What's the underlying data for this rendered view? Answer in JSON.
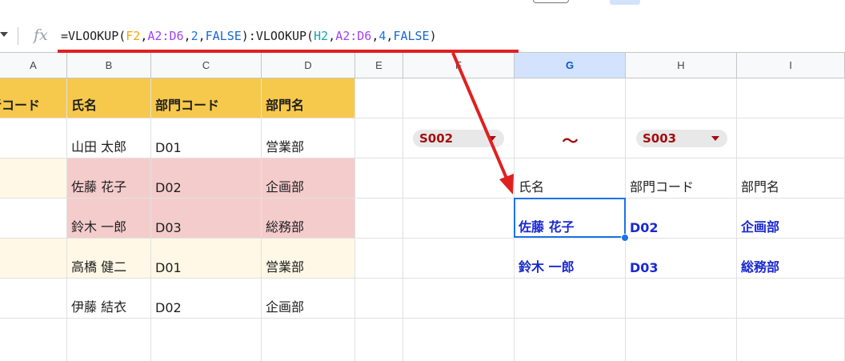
{
  "formula_bar": {
    "fx_label": "fx",
    "formula_parts": [
      {
        "text": "=VLOOKUP(",
        "cls": ""
      },
      {
        "text": "F2",
        "cls": "c-orange"
      },
      {
        "text": ",",
        "cls": ""
      },
      {
        "text": "A2:D6",
        "cls": "c-purple"
      },
      {
        "text": ",",
        "cls": ""
      },
      {
        "text": "2",
        "cls": "c-blue"
      },
      {
        "text": ",",
        "cls": ""
      },
      {
        "text": "FALSE",
        "cls": "c-navy"
      },
      {
        "text": "):VLOOKUP(",
        "cls": ""
      },
      {
        "text": "H2",
        "cls": "c-teal"
      },
      {
        "text": ",",
        "cls": ""
      },
      {
        "text": "A2:D6",
        "cls": "c-purple"
      },
      {
        "text": ",",
        "cls": ""
      },
      {
        "text": "4",
        "cls": "c-blue"
      },
      {
        "text": ",",
        "cls": ""
      },
      {
        "text": "FALSE",
        "cls": "c-navy"
      },
      {
        "text": ")",
        "cls": ""
      }
    ]
  },
  "columns": {
    "A": "A",
    "B": "B",
    "C": "C",
    "D": "D",
    "E": "E",
    "F": "F",
    "G": "G",
    "H": "H",
    "I": "I"
  },
  "rows": {
    "header": {
      "A": "者コード",
      "B": "氏名",
      "C": "部門コード",
      "D": "部門名"
    },
    "r2": {
      "B": "山田 太郎",
      "C": "D01",
      "D": "営業部"
    },
    "r3": {
      "B": "佐藤 花子",
      "C": "D02",
      "D": "企画部"
    },
    "r4": {
      "B": "鈴木 一郎",
      "C": "D03",
      "D": "総務部"
    },
    "r5": {
      "B": "高橋 健二",
      "C": "D01",
      "D": "営業部"
    },
    "r6": {
      "B": "伊藤 結衣",
      "C": "D02",
      "D": "企画部"
    }
  },
  "filter": {
    "from_value": "S002",
    "separator": "～",
    "to_value": "S003"
  },
  "result": {
    "headers": {
      "G": "氏名",
      "H": "部門コード",
      "I": "部門名"
    },
    "rows": [
      {
        "G": "佐藤 花子",
        "H": "D02",
        "I": "企画部"
      },
      {
        "G": "鈴木 一郎",
        "H": "D03",
        "I": "総務部"
      }
    ]
  },
  "colors": {
    "header_fill": "#f6c94c",
    "highlight_pink": "#f4cccc",
    "highlight_cream": "#fff8e6",
    "result_text": "#1a29d1",
    "chip_text": "#a50e0e",
    "annotation_red": "#e02020",
    "selection_blue": "#1a73e8"
  },
  "icons": {
    "name_box": "dropdown-caret-icon",
    "formula": "fx-icon",
    "chip_caret": "dropdown-caret-icon"
  }
}
